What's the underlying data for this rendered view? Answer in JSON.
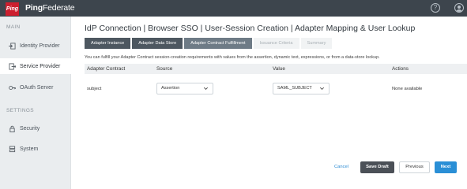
{
  "brand": {
    "logo_text": "Ping",
    "name_bold": "Ping",
    "name_rest": "Federate"
  },
  "topbar": {
    "help_label": "?"
  },
  "sidebar": {
    "main_section": "MAIN",
    "settings_section": "SETTINGS",
    "items": [
      {
        "label": "Identity Provider",
        "icon": "identity-provider-icon"
      },
      {
        "label": "Service Provider",
        "icon": "service-provider-icon",
        "active": true
      },
      {
        "label": "OAuth Server",
        "icon": "oauth-server-icon"
      },
      {
        "label": "Security",
        "icon": "security-icon"
      },
      {
        "label": "System",
        "icon": "system-icon"
      }
    ]
  },
  "page": {
    "title": "IdP Connection | Browser SSO | User-Session Creation | Adapter Mapping & User Lookup",
    "description": "You can fulfill your Adapter Contract session-creation requirements with values from the assertion, dynamic text, expressions, or from a data-store lookup."
  },
  "tabs": [
    {
      "label": "Adapter Instance",
      "state": "done"
    },
    {
      "label": "Adapter Data Store",
      "state": "done"
    },
    {
      "label": "Adapter Contract Fulfillment",
      "state": "current"
    },
    {
      "label": "Issuance Criteria",
      "state": "disabled"
    },
    {
      "label": "Summary",
      "state": "disabled"
    }
  ],
  "table": {
    "headers": [
      "Adapter Contract",
      "Source",
      "Value",
      "Actions"
    ],
    "rows": [
      {
        "contract": "subject",
        "source": "Assertion",
        "value": "SAML_SUBJECT",
        "actions": "None available"
      }
    ]
  },
  "footer": {
    "cancel": "Cancel",
    "save_draft": "Save Draft",
    "previous": "Previous",
    "next": "Next"
  },
  "colors": {
    "topbar": "#3d454d",
    "logo": "#cc1f2f",
    "accent": "#2a8fd6"
  }
}
